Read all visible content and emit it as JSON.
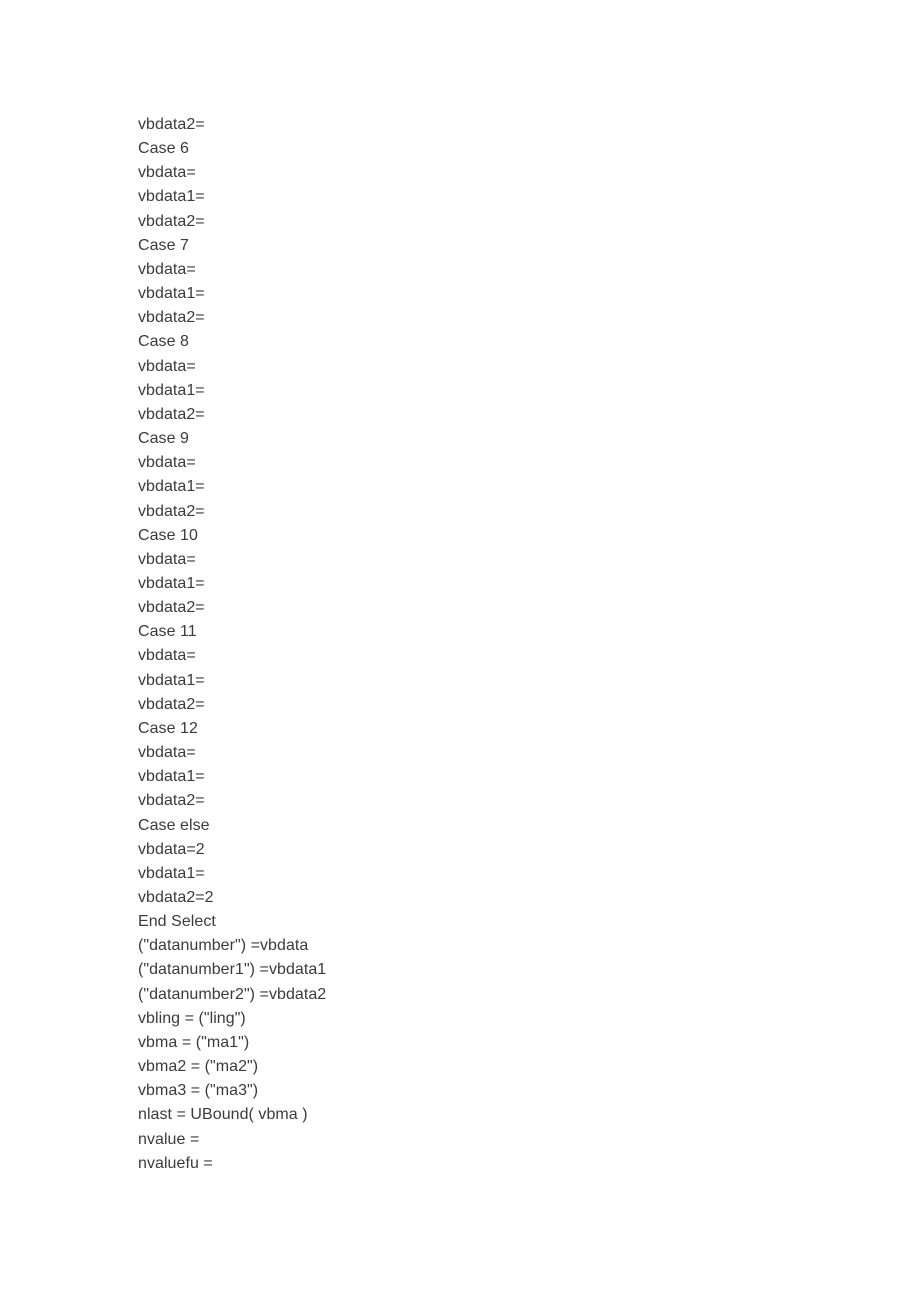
{
  "document": {
    "background_color": "#ffffff",
    "text_color": "#3b3b3b",
    "code_lines": [
      "vbdata2=",
      "Case 6",
      "vbdata=",
      "vbdata1=",
      "vbdata2=",
      "Case 7",
      "vbdata=",
      "vbdata1=",
      "vbdata2=",
      "Case 8",
      "vbdata=",
      "vbdata1=",
      "vbdata2=",
      "Case 9",
      "vbdata=",
      "vbdata1=",
      "vbdata2=",
      "Case 10",
      "vbdata=",
      "vbdata1=",
      "vbdata2=",
      "Case 11",
      "vbdata=",
      "vbdata1=",
      "vbdata2=",
      "Case 12",
      "vbdata=",
      "vbdata1=",
      "vbdata2=",
      "Case else",
      "vbdata=2",
      "vbdata1=",
      "vbdata2=2",
      "End Select",
      "(\"datanumber\") =vbdata",
      "(\"datanumber1\") =vbdata1",
      "(\"datanumber2\") =vbdata2",
      "vbling = (\"ling\")",
      "vbma = (\"ma1\")",
      "vbma2 = (\"ma2\")",
      "vbma3 = (\"ma3\")",
      "nlast = UBound( vbma )",
      "nvalue =",
      "nvaluefu ="
    ]
  }
}
